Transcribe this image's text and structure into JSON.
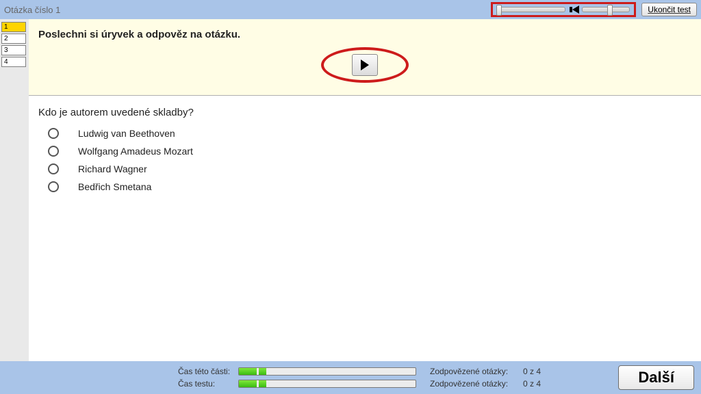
{
  "topbar": {
    "title": "Otázka číslo 1",
    "end_test_label": "Ukončit test"
  },
  "audio": {
    "progress_percent": 0,
    "volume_percent": 55
  },
  "qnav": {
    "items": [
      {
        "num": "1",
        "active": true
      },
      {
        "num": "2",
        "active": false
      },
      {
        "num": "3",
        "active": false
      },
      {
        "num": "4",
        "active": false
      }
    ]
  },
  "instruction": "Poslechni si úryvek a odpověz na otázku.",
  "question": {
    "prompt": "Kdo je autorem uvedené skladby?",
    "options": [
      "Ludwig van Beethoven",
      "Wolfgang Amadeus Mozart",
      "Richard Wagner",
      "Bedřich Smetana"
    ]
  },
  "footer": {
    "part_time_label": "Čas této části:",
    "test_time_label": "Čas testu:",
    "part_progress_percent": 12,
    "test_progress_percent": 12,
    "answered_label": "Zodpovězené otázky:",
    "answered_value": "0 z 4",
    "next_label": "Další"
  }
}
